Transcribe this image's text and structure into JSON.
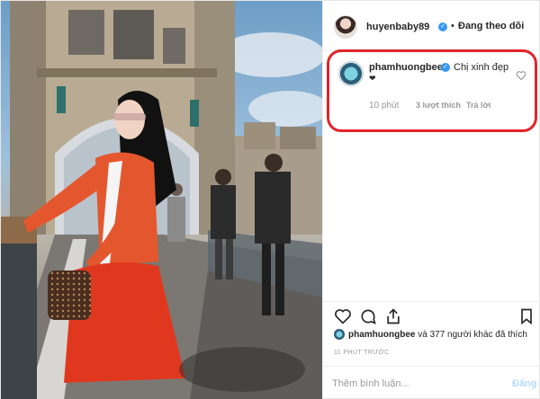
{
  "header": {
    "username": "huyenbaby89",
    "separator": "•",
    "follow_label": "Đang theo dõi"
  },
  "comment": {
    "username": "phamhuongbee",
    "text": "Chị xinh đẹp",
    "heart": "❤",
    "time": "10 phút",
    "likes": "3 lượt thích",
    "reply_label": "Trả lời"
  },
  "likers": {
    "first": "phamhuongbee",
    "rest": " và 377 người khác đã thích"
  },
  "timestamp": "11 PHÚT TRƯỚC",
  "add_comment": {
    "placeholder": "Thêm bình luận...",
    "post_label": "Đăng"
  },
  "colors": {
    "highlight": "#e3232b",
    "verified": "#3897f0",
    "post_disabled": "#b3dbff"
  }
}
